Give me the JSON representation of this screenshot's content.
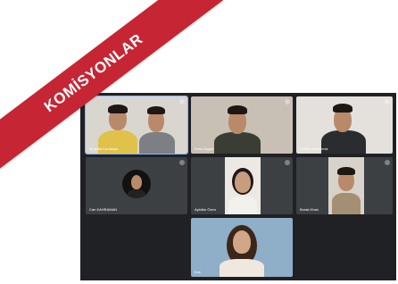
{
  "banner": {
    "label": "KOMİSYONLAR"
  },
  "participants": [
    {
      "name": "Mustafa Karakaya"
    },
    {
      "name": "Enes Aygün"
    },
    {
      "name": "Furkan Karadeniz"
    },
    {
      "name": "Can KAHRAMAN"
    },
    {
      "name": "Aybüke Özen"
    },
    {
      "name": "Burak Khan"
    },
    {
      "name": "Ece"
    }
  ],
  "colors": {
    "ribbon": "#c62533",
    "meeting_bg": "#202124",
    "tile_bg": "#3c4043",
    "active_outline": "#8ab4f8"
  }
}
